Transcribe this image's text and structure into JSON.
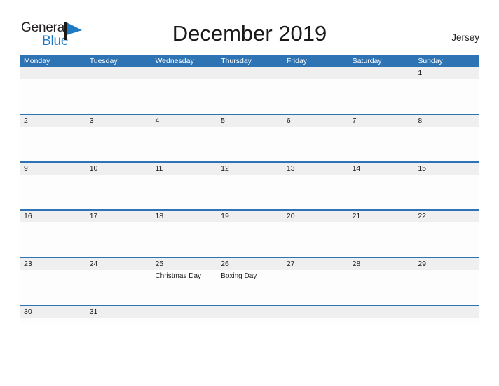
{
  "brand": {
    "name_part1": "General",
    "name_part2": "Blue",
    "flag_icon": "blue-flag-triangle-icon",
    "accent_color": "#1f7ac4"
  },
  "header": {
    "title": "December 2019",
    "region": "Jersey"
  },
  "theme": {
    "header_blue": "#2e74b5",
    "row_band_gray": "#efefef",
    "cell_white": "#fdfdfd",
    "text_black": "#1a1a1a"
  },
  "calendar": {
    "month": "December",
    "year": "2019",
    "weekday_headers": [
      "Monday",
      "Tuesday",
      "Wednesday",
      "Thursday",
      "Friday",
      "Saturday",
      "Sunday"
    ],
    "weeks": [
      {
        "days": [
          {
            "num": "",
            "event": ""
          },
          {
            "num": "",
            "event": ""
          },
          {
            "num": "",
            "event": ""
          },
          {
            "num": "",
            "event": ""
          },
          {
            "num": "",
            "event": ""
          },
          {
            "num": "",
            "event": ""
          },
          {
            "num": "1",
            "event": ""
          }
        ]
      },
      {
        "days": [
          {
            "num": "2",
            "event": ""
          },
          {
            "num": "3",
            "event": ""
          },
          {
            "num": "4",
            "event": ""
          },
          {
            "num": "5",
            "event": ""
          },
          {
            "num": "6",
            "event": ""
          },
          {
            "num": "7",
            "event": ""
          },
          {
            "num": "8",
            "event": ""
          }
        ]
      },
      {
        "days": [
          {
            "num": "9",
            "event": ""
          },
          {
            "num": "10",
            "event": ""
          },
          {
            "num": "11",
            "event": ""
          },
          {
            "num": "12",
            "event": ""
          },
          {
            "num": "13",
            "event": ""
          },
          {
            "num": "14",
            "event": ""
          },
          {
            "num": "15",
            "event": ""
          }
        ]
      },
      {
        "days": [
          {
            "num": "16",
            "event": ""
          },
          {
            "num": "17",
            "event": ""
          },
          {
            "num": "18",
            "event": ""
          },
          {
            "num": "19",
            "event": ""
          },
          {
            "num": "20",
            "event": ""
          },
          {
            "num": "21",
            "event": ""
          },
          {
            "num": "22",
            "event": ""
          }
        ]
      },
      {
        "days": [
          {
            "num": "23",
            "event": ""
          },
          {
            "num": "24",
            "event": ""
          },
          {
            "num": "25",
            "event": "Christmas Day"
          },
          {
            "num": "26",
            "event": "Boxing Day"
          },
          {
            "num": "27",
            "event": ""
          },
          {
            "num": "28",
            "event": ""
          },
          {
            "num": "29",
            "event": ""
          }
        ]
      },
      {
        "days": [
          {
            "num": "30",
            "event": ""
          },
          {
            "num": "31",
            "event": ""
          },
          {
            "num": "",
            "event": ""
          },
          {
            "num": "",
            "event": ""
          },
          {
            "num": "",
            "event": ""
          },
          {
            "num": "",
            "event": ""
          },
          {
            "num": "",
            "event": ""
          }
        ]
      }
    ]
  }
}
